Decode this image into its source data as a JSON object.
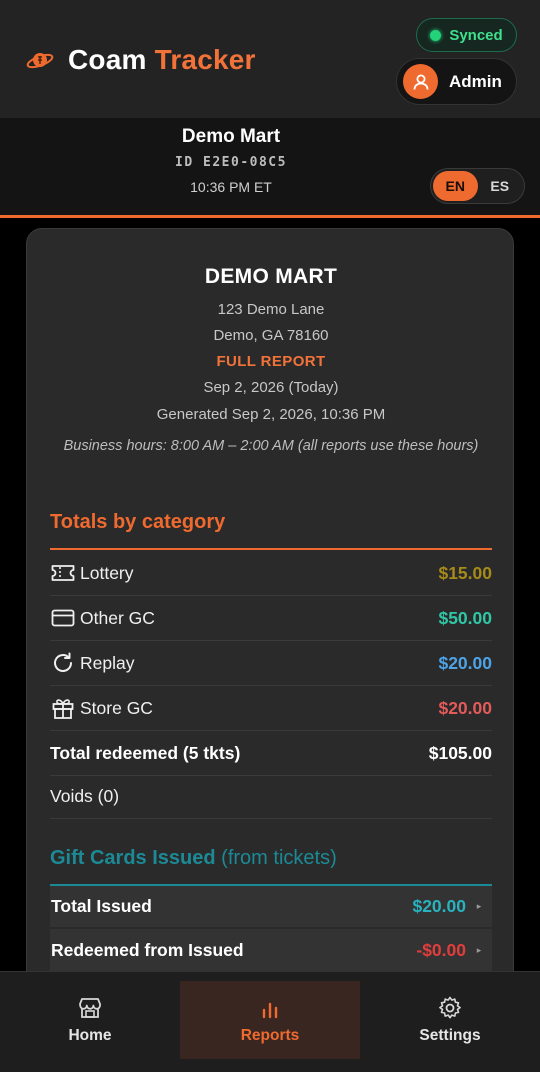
{
  "header": {
    "brand_part1": "Coam",
    "brand_part2": "Tracker",
    "sync_status": "Synced",
    "user_label": "Admin"
  },
  "store": {
    "name": "Demo Mart",
    "id": "ID E2E0-08C5",
    "time": "10:36 PM ET",
    "languages": [
      "EN",
      "ES"
    ],
    "active_language": "EN"
  },
  "report": {
    "store_name": "DEMO MART",
    "address_line1": "123 Demo Lane",
    "address_line2": "Demo, GA 78160",
    "report_type": "FULL REPORT",
    "date": "Sep 2, 2026 (Today)",
    "generated": "Generated Sep 2, 2026, 10:36 PM",
    "hours": "Business hours: 8:00 AM – 2:00 AM (all reports use these hours)"
  },
  "totals": {
    "title": "Totals by category",
    "rows": [
      {
        "icon": "ticket-icon",
        "label": "Lottery",
        "amount": "$15.00",
        "color": "#a68a1a"
      },
      {
        "icon": "credit-card-icon",
        "label": "Other GC",
        "amount": "$50.00",
        "color": "#2fc7a6"
      },
      {
        "icon": "refresh-icon",
        "label": "Replay",
        "amount": "$20.00",
        "color": "#4ea3e6"
      },
      {
        "icon": "gift-icon",
        "label": "Store GC",
        "amount": "$20.00",
        "color": "#e25a5a"
      }
    ],
    "total_label": "Total redeemed (5 tkts)",
    "total_amount": "$105.00",
    "voids_label": "Voids (0)"
  },
  "gift_cards": {
    "title": "Gift Cards Issued",
    "subtitle": "(from tickets)",
    "rows": [
      {
        "label": "Total Issued",
        "amount": "$20.00"
      },
      {
        "label": "Redeemed from Issued",
        "amount": "-$0.00"
      }
    ]
  },
  "nav": {
    "items": [
      {
        "label": "Home",
        "icon": "store-icon"
      },
      {
        "label": "Reports",
        "icon": "bar-chart-icon"
      },
      {
        "label": "Settings",
        "icon": "gear-icon"
      }
    ],
    "active": "Reports"
  },
  "colors": {
    "accent": "#ef6a2f",
    "teal": "#1b8a96",
    "sync_green": "#22d37a"
  }
}
